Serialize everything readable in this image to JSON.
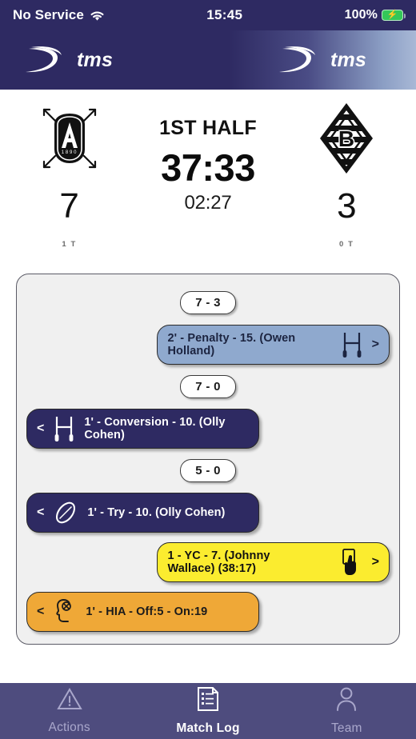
{
  "status_bar": {
    "carrier": "No Service",
    "wifi_icon": "wifi-icon",
    "time": "15:45",
    "battery_percent": "100%",
    "battery_icon": "battery-charging-icon"
  },
  "brand_header": {
    "logo_icon": "tms-swoosh-logo",
    "wordmark_left": "tms",
    "wordmark_right": "tms",
    "gradient_from": "#2e2a62",
    "gradient_to": "#a8b8d6"
  },
  "scoreboard": {
    "period": "1ST HALF",
    "clock": "37:33",
    "sub_clock": "02:27",
    "home": {
      "crest_icon": "team-a-crest-icon",
      "crest_letter": "A",
      "crest_year": "1890",
      "score": "7",
      "tries": "1 T"
    },
    "away": {
      "crest_icon": "team-b-crest-icon",
      "crest_letter": "B",
      "score": "3",
      "tries": "0 T"
    }
  },
  "match_log": {
    "entries": [
      {
        "kind": "score",
        "text": "7 - 3"
      },
      {
        "kind": "event",
        "side": "right",
        "color": "blue",
        "label": "2' - Penalty - 15. (Owen Holland)",
        "icon": "goal-posts-icon",
        "chevron": ">"
      },
      {
        "kind": "score",
        "text": "7 - 0"
      },
      {
        "kind": "event",
        "side": "left",
        "color": "dark",
        "label": "1' - Conversion - 10. (Olly Cohen)",
        "icon": "goal-posts-icon",
        "chevron": "<"
      },
      {
        "kind": "score",
        "text": "5 - 0"
      },
      {
        "kind": "event",
        "side": "left",
        "color": "dark",
        "label": "1' - Try - 10. (Olly Cohen)",
        "icon": "rugby-ball-icon",
        "chevron": "<"
      },
      {
        "kind": "event",
        "side": "right",
        "color": "yellow",
        "label": "1 - YC - 7. (Johnny Wallace) (38:17)",
        "icon": "yellow-card-hand-icon",
        "chevron": ">"
      },
      {
        "kind": "event",
        "side": "left",
        "color": "orange",
        "label": "1' - HIA - Off:5 - On:19",
        "icon": "head-injury-icon",
        "chevron": "<"
      }
    ]
  },
  "tab_bar": {
    "tabs": [
      {
        "label": "Actions",
        "icon": "warning-triangle-icon",
        "active": false
      },
      {
        "label": "Match Log",
        "icon": "document-list-icon",
        "active": true
      },
      {
        "label": "Team",
        "icon": "person-icon",
        "active": false
      }
    ],
    "active_color": "#ffffff",
    "inactive_color": "#a9a7cb",
    "background": "#4e4c7e"
  }
}
